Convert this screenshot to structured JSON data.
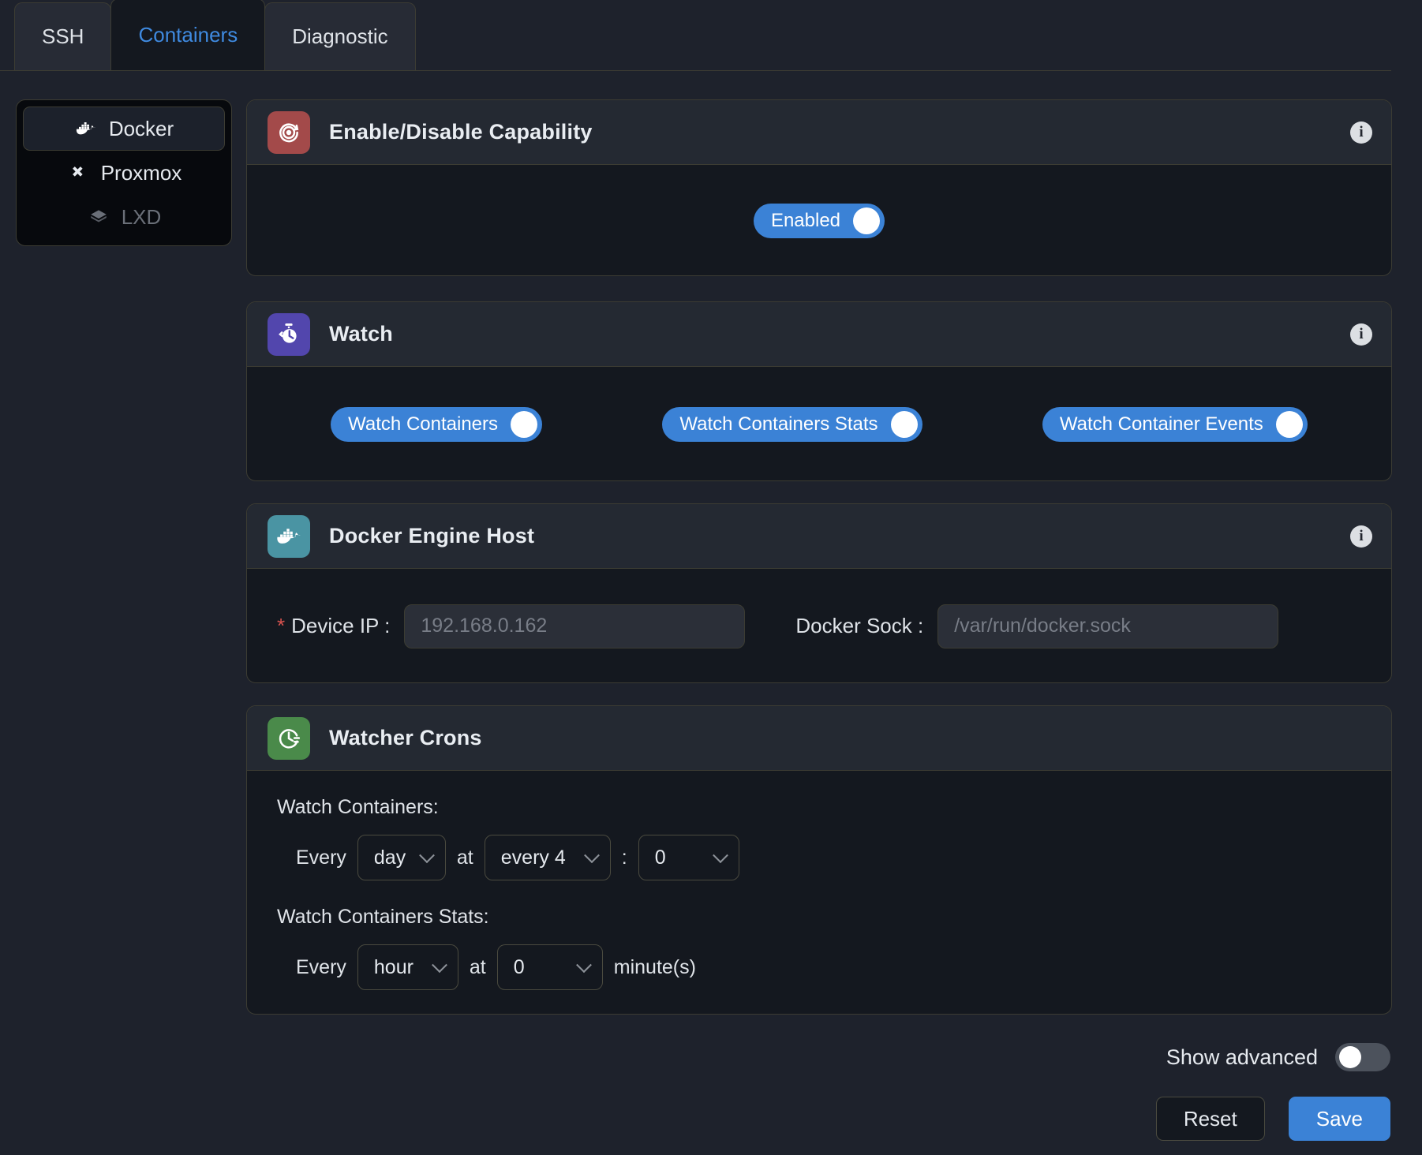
{
  "tabs": [
    {
      "label": "SSH",
      "active": false
    },
    {
      "label": "Containers",
      "active": true
    },
    {
      "label": "Diagnostic",
      "active": false
    }
  ],
  "sidebar": {
    "items": [
      {
        "label": "Docker",
        "icon": "docker-whale-icon",
        "state": "active"
      },
      {
        "label": "Proxmox",
        "icon": "proxmox-icon",
        "state": "normal"
      },
      {
        "label": "LXD",
        "icon": "lxd-box-icon",
        "state": "disabled"
      }
    ]
  },
  "cards": {
    "capability": {
      "title": "Enable/Disable Capability",
      "icon": "target-power-icon",
      "icon_color": "#a34a4a",
      "info_icon": "info-icon",
      "toggle": {
        "label": "Enabled",
        "on": true
      }
    },
    "watch": {
      "title": "Watch",
      "icon": "stopwatch-icon",
      "icon_color": "#5246ad",
      "info_icon": "info-icon",
      "toggles": [
        {
          "label": "Watch Containers",
          "on": true
        },
        {
          "label": "Watch Containers Stats",
          "on": true
        },
        {
          "label": "Watch Container Events",
          "on": true
        }
      ]
    },
    "engine_host": {
      "title": "Docker Engine Host",
      "icon": "docker-whale-icon",
      "icon_color": "#4a94a3",
      "info_icon": "info-icon",
      "fields": [
        {
          "label": "Device IP :",
          "required": true,
          "required_mark": "*",
          "value": "",
          "placeholder": "192.168.0.162"
        },
        {
          "label": "Docker Sock :",
          "required": false,
          "required_mark": "",
          "value": "",
          "placeholder": "/var/run/docker.sock"
        }
      ]
    },
    "crons": {
      "title": "Watcher Crons",
      "icon": "clock-history-icon",
      "icon_color": "#4a8a4a",
      "rows": [
        {
          "label": "Watch Containers:",
          "prefix": "Every",
          "unit": {
            "value": "day",
            "name": "frequency-unit-select"
          },
          "mid": "at",
          "hour": {
            "value": "every 4",
            "name": "hour-select"
          },
          "separator": ":",
          "minute": {
            "value": "0",
            "name": "minute-select"
          },
          "suffix": ""
        },
        {
          "label": "Watch Containers Stats:",
          "prefix": "Every",
          "unit": {
            "value": "hour",
            "name": "frequency-unit-select"
          },
          "mid": "at",
          "hour": null,
          "separator": "",
          "minute": {
            "value": "0",
            "name": "minute-select"
          },
          "suffix": "minute(s)"
        }
      ]
    }
  },
  "footer": {
    "show_advanced_label": "Show advanced",
    "show_advanced_on": false,
    "reset_label": "Reset",
    "save_label": "Save"
  },
  "colors": {
    "page_bg": "#1e222c",
    "card_bg": "#14181f",
    "card_header_bg": "#242932",
    "border": "#3c3c33",
    "accent_blue": "#3b82d6",
    "tab_active_text": "#3f8ae0",
    "required_red": "#d9534f"
  }
}
